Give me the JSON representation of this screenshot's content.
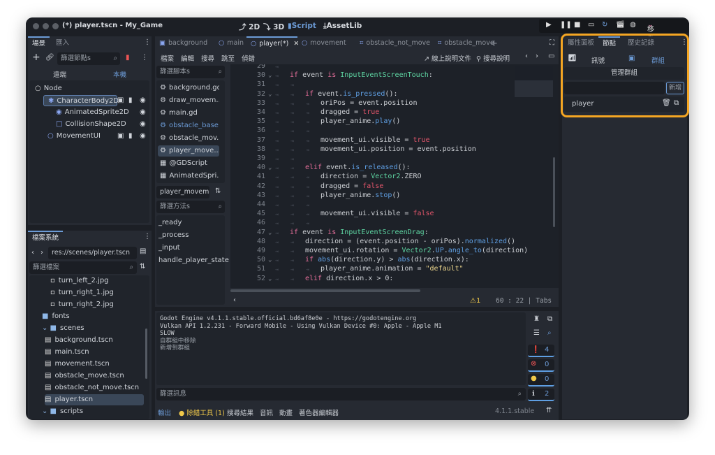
{
  "window": {
    "title": "(*) player.tscn - My_Game",
    "modes": [
      {
        "icon": "2d-icon",
        "label": "2D"
      },
      {
        "icon": "3d-icon",
        "label": "3D"
      },
      {
        "icon": "script-icon",
        "label": "Script",
        "active": true
      },
      {
        "icon": "assetlib-icon",
        "label": "AssetLib"
      }
    ],
    "device_label": "移動裝置",
    "run_icons": [
      "play-icon",
      "pause-icon",
      "stop-icon",
      "remote-debug-icon",
      "reload-icon",
      "movie-icon",
      "pick-icon"
    ]
  },
  "scene_dock": {
    "tabs": [
      "場景",
      "匯入"
    ],
    "filter_placeholder": "篩選節點s",
    "remote": "遠端",
    "local": "本機",
    "nodes": [
      {
        "label": "Node",
        "icon": "node-icon",
        "depth": 0
      },
      {
        "label": "CharacterBody2D",
        "icon": "character-body-icon",
        "depth": 1,
        "selected": true
      },
      {
        "label": "AnimatedSprite2D",
        "icon": "animated-sprite-icon",
        "depth": 2
      },
      {
        "label": "CollisionShape2D",
        "icon": "collision-shape-icon",
        "depth": 2
      },
      {
        "label": "MovementUI",
        "icon": "control-icon",
        "depth": 1
      }
    ]
  },
  "filesystem": {
    "tab": "檔案系統",
    "path": "res://scenes/player.tscn",
    "filter_placeholder": "篩選檔案",
    "items": [
      {
        "label": "turn_left_2.jpg",
        "type": "image",
        "depth": 2
      },
      {
        "label": "turn_right_1.jpg",
        "type": "image",
        "depth": 2
      },
      {
        "label": "turn_right_2.jpg",
        "type": "image",
        "depth": 2
      },
      {
        "label": "fonts",
        "type": "folder",
        "depth": 1
      },
      {
        "label": "scenes",
        "type": "folder",
        "depth": 1
      },
      {
        "label": "background.tscn",
        "type": "scene",
        "depth": 2
      },
      {
        "label": "main.tscn",
        "type": "scene",
        "depth": 2
      },
      {
        "label": "movement.tscn",
        "type": "scene",
        "depth": 2
      },
      {
        "label": "obstacle_move.tscn",
        "type": "scene",
        "depth": 2
      },
      {
        "label": "obstacle_not_move.tscn",
        "type": "scene",
        "depth": 2
      },
      {
        "label": "player.tscn",
        "type": "scene",
        "depth": 2,
        "selected": true
      },
      {
        "label": "scripts",
        "type": "folder",
        "depth": 1
      }
    ]
  },
  "editor": {
    "tabs": [
      {
        "label": "background",
        "icon": "node2d-icon"
      },
      {
        "label": "main",
        "icon": "node-icon"
      },
      {
        "label": "player(*)",
        "icon": "node-icon",
        "active": true
      },
      {
        "label": "movement",
        "icon": "node-icon"
      },
      {
        "label": "obstacle_not_move",
        "icon": "area-icon"
      },
      {
        "label": "obstacle_move",
        "icon": "area-icon"
      }
    ],
    "menu": [
      "檔案",
      "編輯",
      "搜尋",
      "跳至",
      "偵錯"
    ],
    "online_docs": "線上說明文件",
    "search_help": "搜尋說明",
    "script_filter_placeholder": "篩選腳本s",
    "scripts": [
      {
        "label": "background.gd"
      },
      {
        "label": "draw_movem..."
      },
      {
        "label": "main.gd"
      },
      {
        "label": "obstacle_base...",
        "highlight": true
      },
      {
        "label": "obstacle_mov..."
      },
      {
        "label": "player_move...",
        "selected": true
      },
      {
        "label": "@GDScript",
        "doc": true
      },
      {
        "label": "AnimatedSpri...",
        "doc": true
      }
    ],
    "current_script": "player_movemen",
    "method_filter_placeholder": "篩選方法s",
    "methods": [
      "_ready",
      "_process",
      "_input",
      "handle_player_state"
    ],
    "code_start_line": 29,
    "code": [
      {
        "i": 1,
        "t": []
      },
      {
        "i": 1,
        "f": 1,
        "t": [
          [
            "kw",
            "if"
          ],
          [
            "tx",
            " event "
          ],
          [
            "kw",
            "is"
          ],
          [
            "tx",
            " "
          ],
          [
            "type",
            "InputEventScreenTouch"
          ],
          [
            "tx",
            ":"
          ]
        ]
      },
      {
        "i": 2,
        "t": []
      },
      {
        "i": 2,
        "f": 1,
        "t": [
          [
            "kw",
            "if"
          ],
          [
            "tx",
            " event."
          ],
          [
            "fn",
            "is_pressed"
          ],
          [
            "tx",
            "():"
          ]
        ]
      },
      {
        "i": 3,
        "t": [
          [
            "tx",
            "oriPos = event.position"
          ]
        ]
      },
      {
        "i": 3,
        "t": [
          [
            "tx",
            "dragged = "
          ],
          [
            "bool",
            "true"
          ]
        ]
      },
      {
        "i": 3,
        "t": [
          [
            "tx",
            "player_anime."
          ],
          [
            "fn",
            "play"
          ],
          [
            "tx",
            "()"
          ]
        ]
      },
      {
        "i": 3,
        "t": []
      },
      {
        "i": 3,
        "t": [
          [
            "tx",
            "movement_ui.visible = "
          ],
          [
            "bool",
            "true"
          ]
        ]
      },
      {
        "i": 3,
        "t": [
          [
            "tx",
            "movement_ui.position = event.position"
          ]
        ]
      },
      {
        "i": 2,
        "t": []
      },
      {
        "i": 2,
        "f": 1,
        "t": [
          [
            "kw",
            "elif"
          ],
          [
            "tx",
            " event."
          ],
          [
            "fn",
            "is_released"
          ],
          [
            "tx",
            "():"
          ]
        ]
      },
      {
        "i": 3,
        "t": [
          [
            "tx",
            "direction = "
          ],
          [
            "type",
            "Vector2"
          ],
          [
            "tx",
            ".ZERO"
          ]
        ]
      },
      {
        "i": 3,
        "t": [
          [
            "tx",
            "dragged = "
          ],
          [
            "bool",
            "false"
          ]
        ]
      },
      {
        "i": 3,
        "t": [
          [
            "tx",
            "player_anime."
          ],
          [
            "fn",
            "stop"
          ],
          [
            "tx",
            "()"
          ]
        ]
      },
      {
        "i": 3,
        "t": []
      },
      {
        "i": 3,
        "t": [
          [
            "tx",
            "movement_ui.visible = "
          ],
          [
            "bool",
            "false"
          ]
        ]
      },
      {
        "i": 3,
        "t": []
      },
      {
        "i": 1,
        "f": 1,
        "t": [
          [
            "kw",
            "if"
          ],
          [
            "tx",
            " event "
          ],
          [
            "kw",
            "is"
          ],
          [
            "tx",
            " "
          ],
          [
            "type",
            "InputEventScreenDrag"
          ],
          [
            "tx",
            ":"
          ]
        ]
      },
      {
        "i": 2,
        "t": [
          [
            "tx",
            "direction = (event.position - oriPos)."
          ],
          [
            "fn",
            "normalized"
          ],
          [
            "tx",
            "()"
          ]
        ]
      },
      {
        "i": 2,
        "t": [
          [
            "tx",
            "movement_ui.rotation = "
          ],
          [
            "type",
            "Vector2"
          ],
          [
            "tx",
            "."
          ],
          [
            "fn",
            "UP"
          ],
          [
            "tx",
            "."
          ],
          [
            "fn",
            "angle_to"
          ],
          [
            "tx",
            "(direction)"
          ]
        ]
      },
      {
        "i": 2,
        "f": 1,
        "t": [
          [
            "kw",
            "if"
          ],
          [
            "tx",
            " "
          ],
          [
            "fn",
            "abs"
          ],
          [
            "tx",
            "(direction.y) > "
          ],
          [
            "fn",
            "abs"
          ],
          [
            "tx",
            "(direction.x):"
          ]
        ]
      },
      {
        "i": 3,
        "t": [
          [
            "tx",
            "player_anime.animation = "
          ],
          [
            "str",
            "\"default\""
          ]
        ]
      },
      {
        "i": 2,
        "f": 1,
        "t": [
          [
            "kw",
            "elif"
          ],
          [
            "tx",
            " direction.x > 0:"
          ]
        ]
      }
    ],
    "status": {
      "warnings": "1",
      "line": "60",
      "col": "22",
      "indent": "Tabs"
    }
  },
  "output": {
    "lines": [
      "Godot Engine v4.1.1.stable.official.bd6af8e0e - https://godotengine.org",
      "Vulkan API 1.2.231 - Forward Mobile - Using Vulkan Device #0: Apple - Apple M1",
      "",
      "SLOW",
      "自群組中移除",
      "新增到群組"
    ],
    "filter_placeholder": "篩選訊息",
    "counts": {
      "messages": "4",
      "errors": "0",
      "warnings": "0",
      "info": "2"
    }
  },
  "bottom_tabs": [
    {
      "label": "輸出",
      "active": true
    },
    {
      "label": "除錯工具 (1)",
      "warn": true
    },
    {
      "label": "搜尋結果"
    },
    {
      "label": "音訊"
    },
    {
      "label": "動畫"
    },
    {
      "label": "著色器編輯器"
    }
  ],
  "version": "4.1.1.stable",
  "right_dock": {
    "tabs": [
      "屬性面板",
      "節點",
      "歷史記錄"
    ],
    "active_tab": 1,
    "signals": "訊號",
    "groups": "群組",
    "manage_groups": "管理群組",
    "group_input": "",
    "add_button": "新增",
    "groups_list": [
      "player"
    ]
  },
  "colors": {
    "accent": "#6c9bd6",
    "highlight_border": "#f5a623",
    "device": "#e06c9f"
  }
}
